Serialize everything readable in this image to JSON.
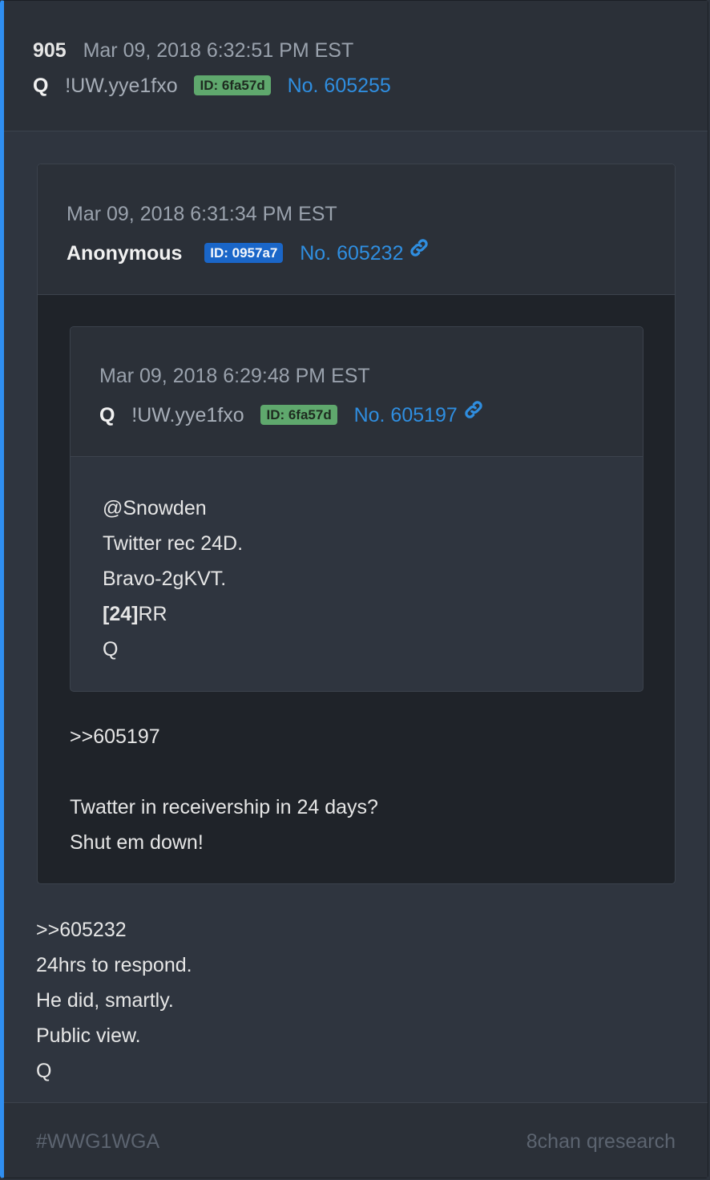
{
  "post": {
    "number": "905",
    "date": "Mar 09, 2018 6:32:51 PM EST",
    "name": "Q",
    "tripcode": "!UW.yye1fxo",
    "id_badge": "ID: 6fa57d",
    "post_no": "No. 605255",
    "body": [
      ">>605232",
      "24hrs to respond.",
      "He did, smartly.",
      "Public view.",
      "Q"
    ]
  },
  "quote1": {
    "date": "Mar 09, 2018 6:31:34 PM EST",
    "name": "Anonymous",
    "id_badge": "ID: 0957a7",
    "post_no": "No. 605232",
    "body": [
      ">>605197",
      "",
      "Twatter in receivership in 24 days?",
      "Shut em down!"
    ]
  },
  "quote2": {
    "date": "Mar 09, 2018 6:29:48 PM EST",
    "name": "Q",
    "tripcode": "!UW.yye1fxo",
    "id_badge": "ID: 6fa57d",
    "post_no": "No. 605197",
    "body_lines": [
      "@Snowden",
      "Twitter rec 24D.",
      "Bravo-2gKVT."
    ],
    "body_bold": "[24]",
    "body_bold_rest": "RR",
    "body_sign": "Q"
  },
  "footer": {
    "hashtag": "#WWG1WGA",
    "source": "8chan qresearch"
  },
  "colors": {
    "accent": "#2f8ef0",
    "link": "#2f8ee0",
    "badge_green": "#5fa86d",
    "badge_blue": "#1a66c8"
  },
  "icons": [
    "link-chain-icon"
  ]
}
